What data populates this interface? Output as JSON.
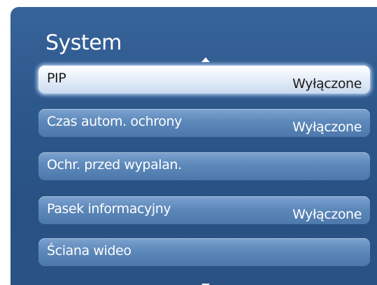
{
  "menu": {
    "title": "System",
    "items": [
      {
        "label": "PIP",
        "value": "Wyłączone",
        "selected": true
      },
      {
        "label": "Czas autom. ochrony",
        "value": "Wyłączone",
        "selected": false
      },
      {
        "label": "Ochr. przed wypalan.",
        "value": "",
        "selected": false
      },
      {
        "label": "Pasek informacyjny",
        "value": "Wyłączone",
        "selected": false
      },
      {
        "label": "Ściana wideo",
        "value": "",
        "selected": false
      }
    ]
  },
  "icons": {
    "scroll_up": "triangle-up-icon",
    "scroll_down": "triangle-down-icon"
  },
  "colors": {
    "panel_background": "#2d588c",
    "item_background": "#5d88ba",
    "selected_item_background": "#eaf1fa",
    "text": "#ffffff",
    "selected_text": "#1b1b1b"
  }
}
